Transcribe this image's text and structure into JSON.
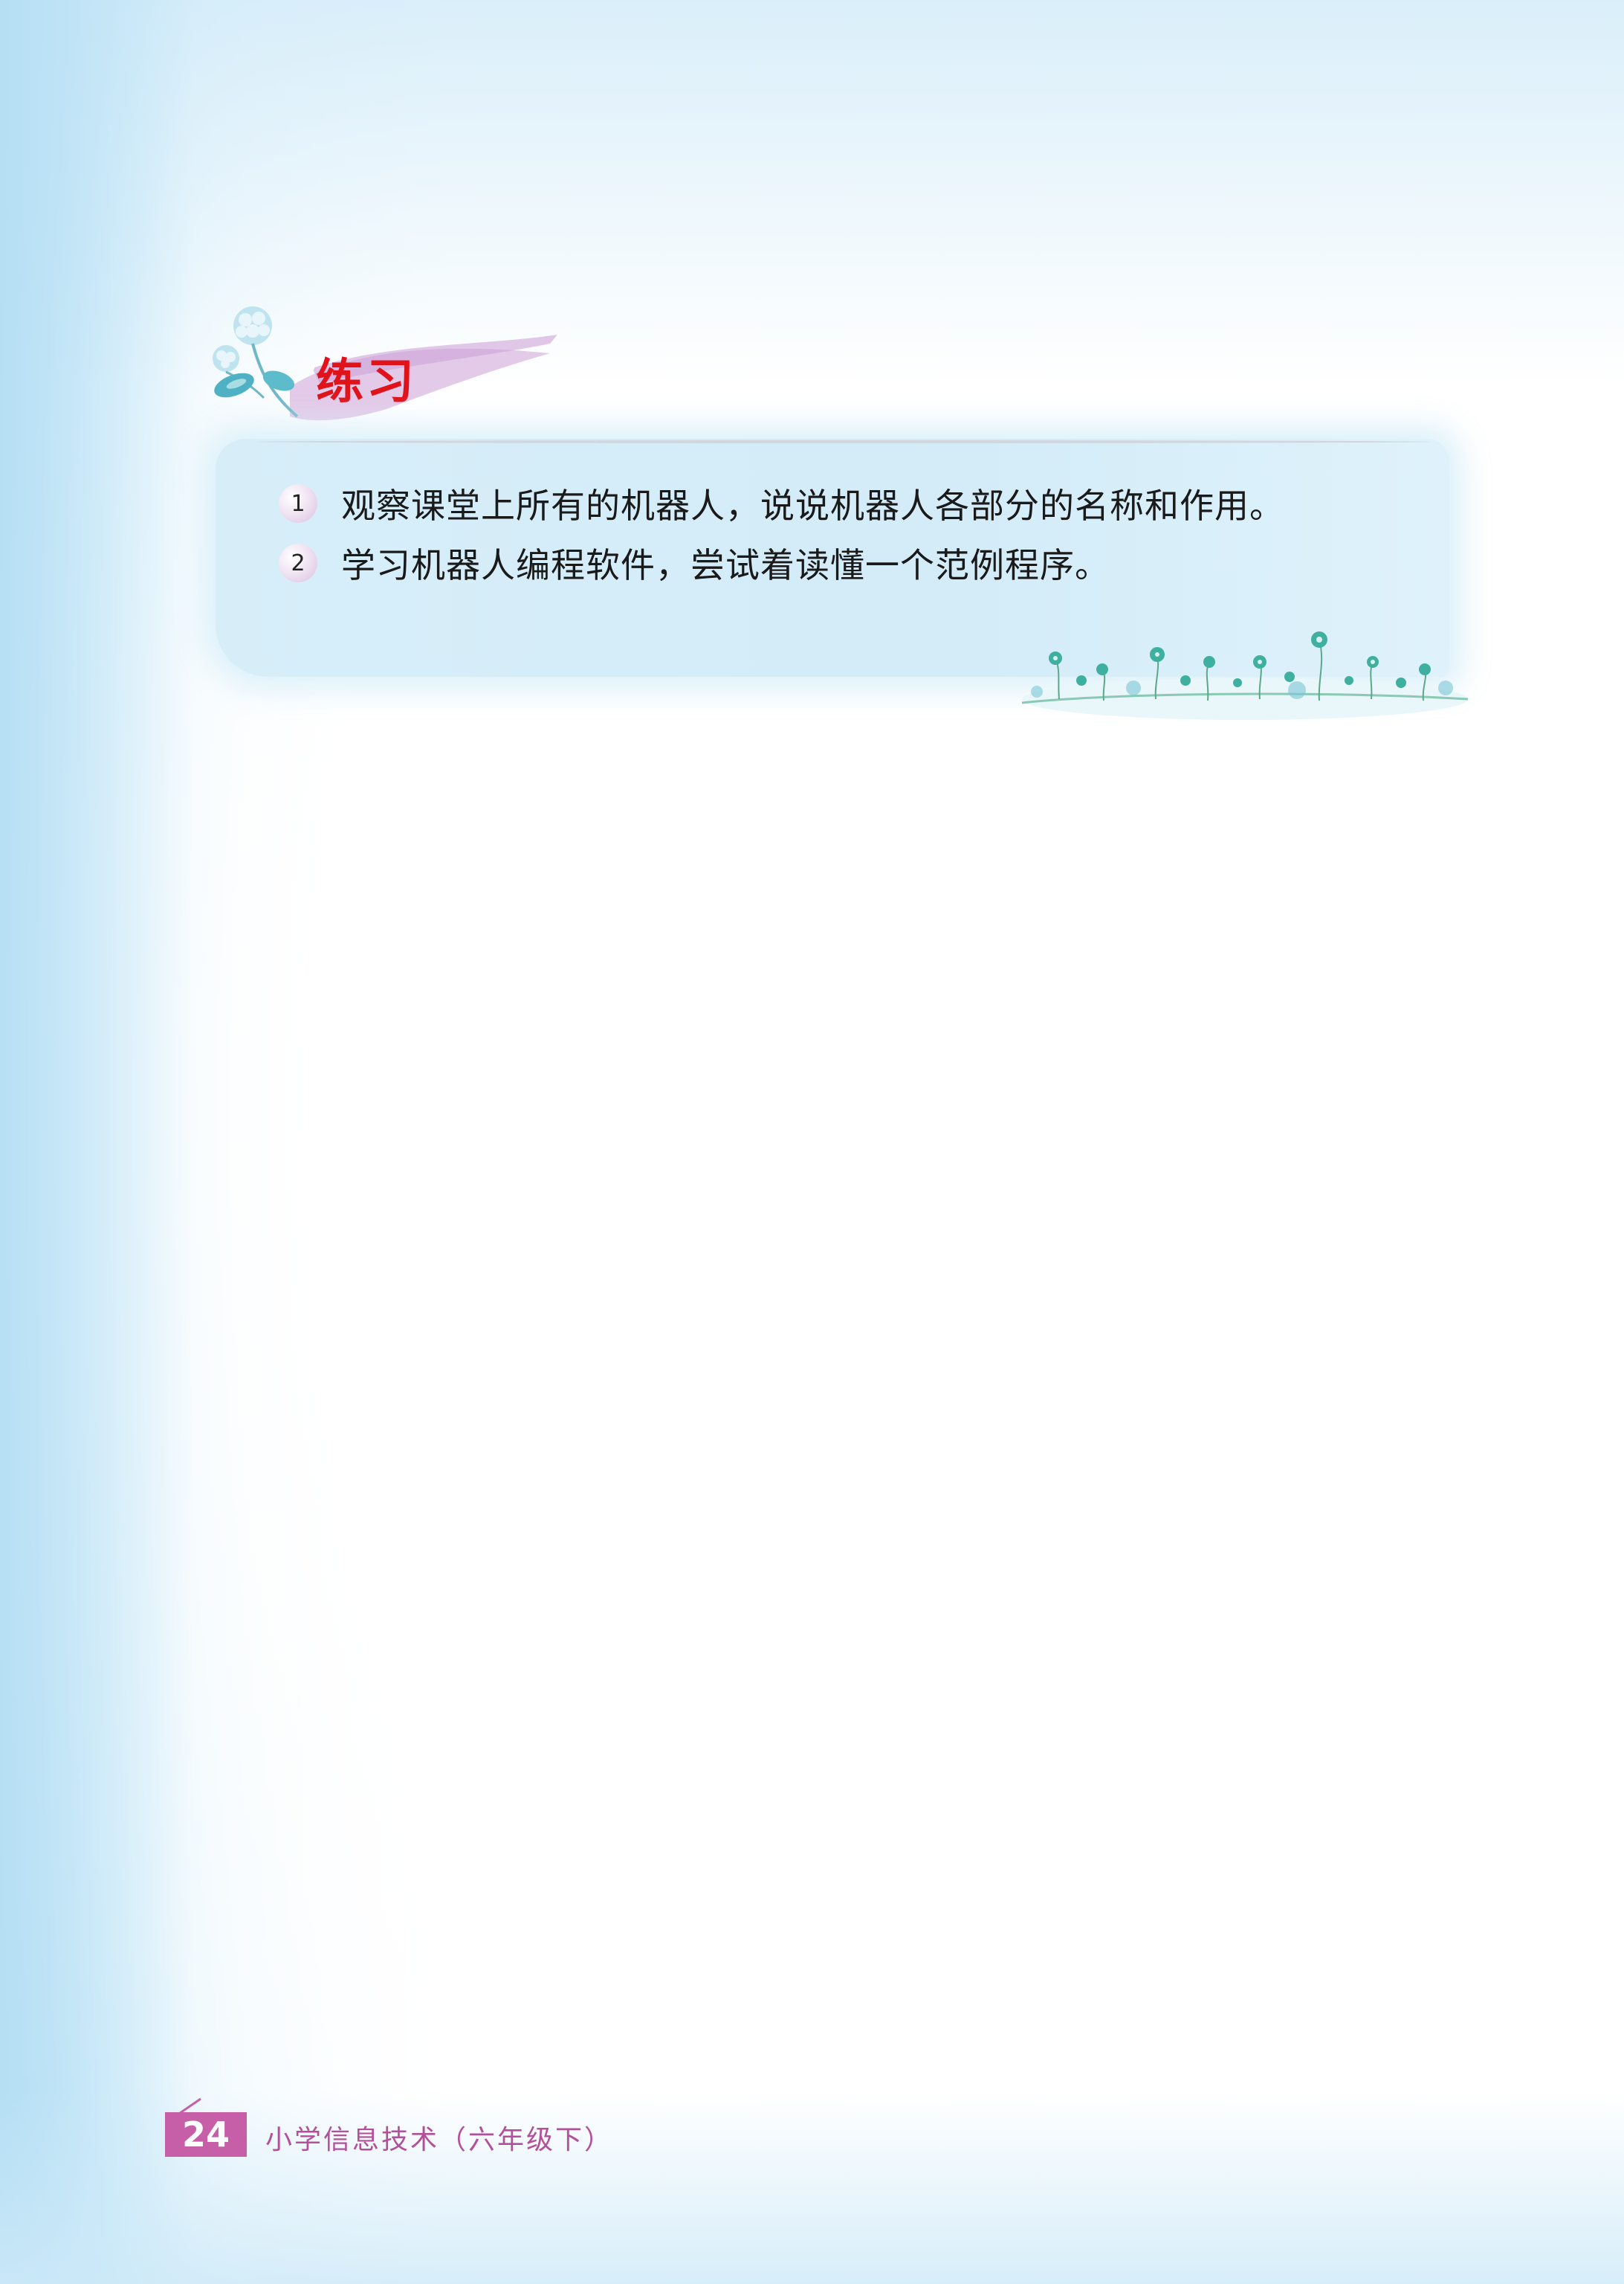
{
  "section": {
    "title": "练习"
  },
  "exercises": [
    {
      "number": "1",
      "text": "观察课堂上所有的机器人，说说机器人各部分的名称和作用。"
    },
    {
      "number": "2",
      "text": "学习机器人编程软件，尝试着读懂一个范例程序。"
    }
  ],
  "footer": {
    "page_number": "24",
    "book_title": "小学信息技术（六年级下）"
  },
  "colors": {
    "title_red": "#e0121a",
    "footer_magenta": "#c65ea8",
    "panel_blue": "#d3ecf8"
  },
  "icons": {
    "header_decoration": "hydrangea-flower-icon",
    "panel_decoration": "flower-meadow-icon"
  }
}
